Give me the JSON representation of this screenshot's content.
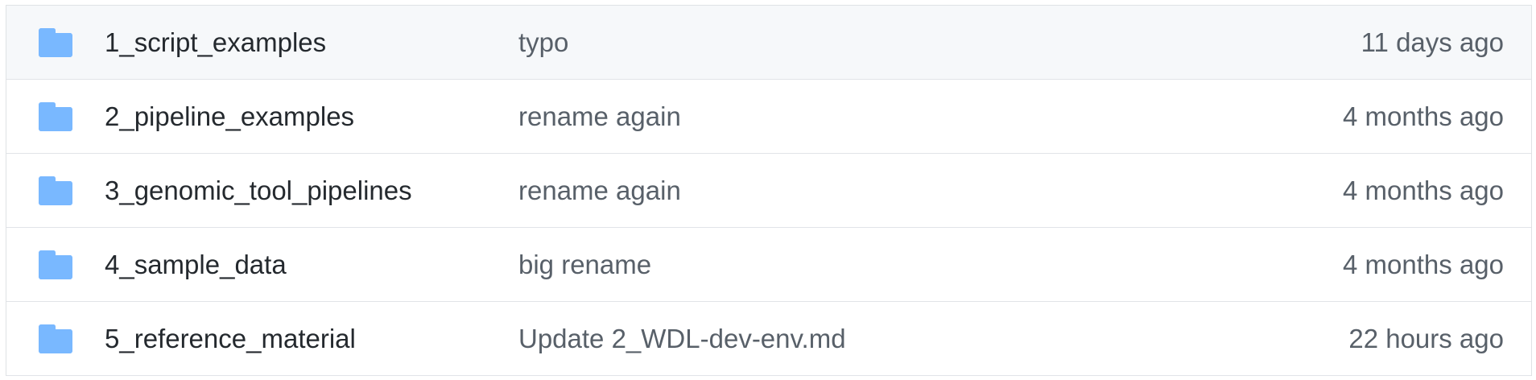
{
  "colors": {
    "folder_icon": "#79b8ff",
    "name_text": "#24292e",
    "secondary_text": "#586069",
    "row_border": "#e1e4e8",
    "hover_row_bg": "#f6f8fa"
  },
  "file_list": {
    "rows": [
      {
        "icon": "folder-icon",
        "name": "1_script_examples",
        "message": "typo",
        "age": "11 days ago"
      },
      {
        "icon": "folder-icon",
        "name": "2_pipeline_examples",
        "message": "rename again",
        "age": "4 months ago"
      },
      {
        "icon": "folder-icon",
        "name": "3_genomic_tool_pipelines",
        "message": "rename again",
        "age": "4 months ago"
      },
      {
        "icon": "folder-icon",
        "name": "4_sample_data",
        "message": "big rename",
        "age": "4 months ago"
      },
      {
        "icon": "folder-icon",
        "name": "5_reference_material",
        "message": "Update 2_WDL-dev-env.md",
        "age": "22 hours ago"
      }
    ]
  }
}
